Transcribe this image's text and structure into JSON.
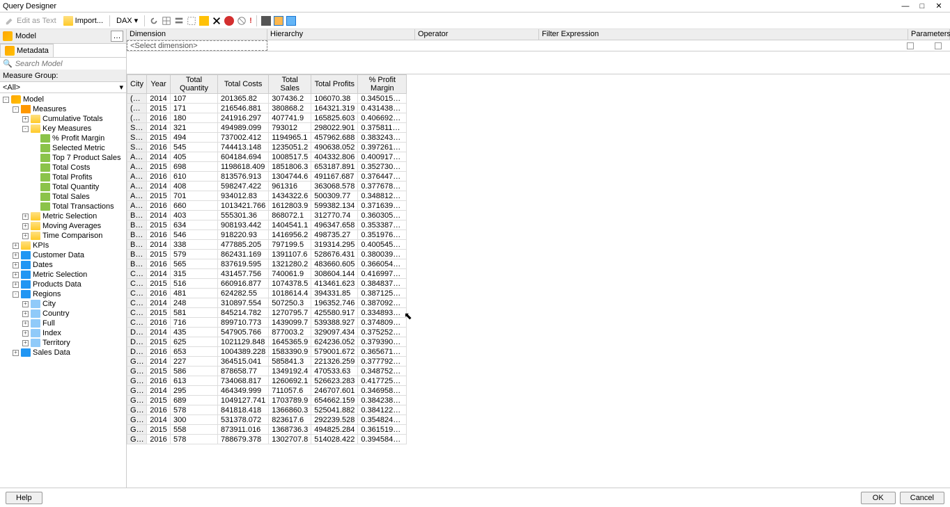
{
  "window": {
    "title": "Query Designer"
  },
  "toolbar": {
    "edit_as_text": "Edit as Text",
    "import": "Import...",
    "mode": "DAX"
  },
  "left": {
    "model_label": "Model",
    "metadata_tab": "Metadata",
    "search_placeholder": "Search Model",
    "measure_group_label": "Measure Group:",
    "measure_group_value": "<All>"
  },
  "tree": [
    {
      "d": 0,
      "e": "-",
      "i": "cube",
      "t": "Model"
    },
    {
      "d": 1,
      "e": "-",
      "i": "bars",
      "t": "Measures"
    },
    {
      "d": 2,
      "e": "+",
      "i": "folder",
      "t": "Cumulative Totals"
    },
    {
      "d": 2,
      "e": "-",
      "i": "folder",
      "t": "Key Measures"
    },
    {
      "d": 3,
      "e": "",
      "i": "calc",
      "t": "% Profit Margin"
    },
    {
      "d": 3,
      "e": "",
      "i": "calc",
      "t": "Selected Metric"
    },
    {
      "d": 3,
      "e": "",
      "i": "calc",
      "t": "Top 7 Product Sales"
    },
    {
      "d": 3,
      "e": "",
      "i": "calc",
      "t": "Total Costs"
    },
    {
      "d": 3,
      "e": "",
      "i": "calc",
      "t": "Total Profits"
    },
    {
      "d": 3,
      "e": "",
      "i": "calc",
      "t": "Total Quantity"
    },
    {
      "d": 3,
      "e": "",
      "i": "calc",
      "t": "Total Sales"
    },
    {
      "d": 3,
      "e": "",
      "i": "calc",
      "t": "Total Transactions"
    },
    {
      "d": 2,
      "e": "+",
      "i": "folder",
      "t": "Metric Selection"
    },
    {
      "d": 2,
      "e": "+",
      "i": "folder",
      "t": "Moving Averages"
    },
    {
      "d": 2,
      "e": "+",
      "i": "folder",
      "t": "Time Comparison"
    },
    {
      "d": 1,
      "e": "+",
      "i": "folder",
      "t": "KPIs"
    },
    {
      "d": 1,
      "e": "+",
      "i": "dim",
      "t": "Customer Data"
    },
    {
      "d": 1,
      "e": "+",
      "i": "dim",
      "t": "Dates"
    },
    {
      "d": 1,
      "e": "+",
      "i": "dim",
      "t": "Metric Selection"
    },
    {
      "d": 1,
      "e": "+",
      "i": "dim",
      "t": "Products Data"
    },
    {
      "d": 1,
      "e": "-",
      "i": "dim",
      "t": "Regions"
    },
    {
      "d": 2,
      "e": "+",
      "i": "attr",
      "t": "City"
    },
    {
      "d": 2,
      "e": "+",
      "i": "attr",
      "t": "Country"
    },
    {
      "d": 2,
      "e": "+",
      "i": "attr",
      "t": "Full"
    },
    {
      "d": 2,
      "e": "+",
      "i": "attr",
      "t": "Index"
    },
    {
      "d": 2,
      "e": "+",
      "i": "attr",
      "t": "Territory"
    },
    {
      "d": 1,
      "e": "+",
      "i": "dim",
      "t": "Sales Data"
    }
  ],
  "filter": {
    "dimension": "Dimension",
    "hierarchy": "Hierarchy",
    "operator": "Operator",
    "expression": "Filter Expression",
    "parameters": "Parameters",
    "select_dim": "<Select dimension>"
  },
  "grid": {
    "headers": [
      "City",
      "Year",
      "Total Quantity",
      "Total Costs",
      "Total Sales",
      "Total Profits",
      "% Profit Margin"
    ],
    "rows": [
      [
        "(null)",
        "2014",
        "107",
        "201365.82",
        "307436.2",
        "106070.38",
        "0.34501590899..."
      ],
      [
        "(null)",
        "2015",
        "171",
        "216546.881",
        "380868.2",
        "164321.319",
        "0.43143879956..."
      ],
      [
        "(null)",
        "2016",
        "180",
        "241916.297",
        "407741.9",
        "165825.603",
        "0.40669257439..."
      ],
      [
        "Syd...",
        "2014",
        "321",
        "494989.099",
        "793012",
        "298022.901",
        "0.37581133828..."
      ],
      [
        "Syd...",
        "2015",
        "494",
        "737002.412",
        "1194965.1",
        "457962.688",
        "0.38324356753..."
      ],
      [
        "Syd...",
        "2016",
        "545",
        "744413.148",
        "1235051.2",
        "490638.052",
        "0.39726130544..."
      ],
      [
        "Alb...",
        "2014",
        "405",
        "604184.694",
        "1008517.5",
        "404332.806",
        "0.40091798704..."
      ],
      [
        "Alb...",
        "2015",
        "698",
        "1198618.409",
        "1851806.3",
        "653187.891",
        "0.35273013759..."
      ],
      [
        "Alb...",
        "2016",
        "610",
        "813576.913",
        "1304744.6",
        "491167.687",
        "0.37644738058..."
      ],
      [
        "Ar...",
        "2014",
        "408",
        "598247.422",
        "961316",
        "363068.578",
        "0.37767870086..."
      ],
      [
        "Ar...",
        "2015",
        "701",
        "934012.83",
        "1434322.6",
        "500309.77",
        "0.34881258232..."
      ],
      [
        "Ar...",
        "2016",
        "660",
        "1013421.766",
        "1612803.9",
        "599382.134",
        "0.37163980940..."
      ],
      [
        "Bat...",
        "2014",
        "403",
        "555301.36",
        "868072.1",
        "312770.74",
        "0.36030502535..."
      ],
      [
        "Bat...",
        "2015",
        "634",
        "908193.442",
        "1404541.1",
        "496347.658",
        "0.35338777768..."
      ],
      [
        "Bat...",
        "2016",
        "546",
        "918220.93",
        "1416956.2",
        "498735.27",
        "0.35197649016..."
      ],
      [
        "Bro...",
        "2014",
        "338",
        "477885.205",
        "797199.5",
        "319314.295",
        "0.40054502668..."
      ],
      [
        "Bro...",
        "2015",
        "579",
        "862431.169",
        "1391107.6",
        "528676.431",
        "0.38003992717..."
      ],
      [
        "Bro...",
        "2016",
        "565",
        "837619.595",
        "1321280.2",
        "483660.605",
        "0.36605453180..."
      ],
      [
        "Ces...",
        "2014",
        "315",
        "431457.756",
        "740061.9",
        "308604.144",
        "0.41699774572..."
      ],
      [
        "Ces...",
        "2015",
        "516",
        "660916.877",
        "1074378.5",
        "413461.623",
        "0.38483795329..."
      ],
      [
        "Ces...",
        "2016",
        "481",
        "624282.55",
        "1018614.4",
        "394331.85",
        "0.38712573668..."
      ],
      [
        "Cof...",
        "2014",
        "248",
        "310897.554",
        "507250.3",
        "196352.746",
        "0.38709241965..."
      ],
      [
        "Cof...",
        "2015",
        "581",
        "845214.782",
        "1270795.7",
        "425580.917",
        "0.33489326254..."
      ],
      [
        "Cof...",
        "2016",
        "716",
        "899710.773",
        "1439099.7",
        "539388.927",
        "0.37480997807..."
      ],
      [
        "Du...",
        "2014",
        "435",
        "547905.766",
        "877003.2",
        "329097.434",
        "0.37525226133..."
      ],
      [
        "Du...",
        "2015",
        "625",
        "1021129.848",
        "1645365.9",
        "624236.052",
        "0.37939041522..."
      ],
      [
        "Du...",
        "2016",
        "653",
        "1004389.228",
        "1583390.9",
        "579001.672",
        "0.36567197146..."
      ],
      [
        "Go...",
        "2014",
        "227",
        "364515.041",
        "585841.3",
        "221326.259",
        "0.37779217511..."
      ],
      [
        "Go...",
        "2015",
        "586",
        "878658.77",
        "1349192.4",
        "470533.63",
        "0.34875206086..."
      ],
      [
        "Go...",
        "2016",
        "613",
        "734068.817",
        "1260692.1",
        "526623.283",
        "0.41772553583..."
      ],
      [
        "Go...",
        "2014",
        "295",
        "464349.999",
        "711057.6",
        "246707.601",
        "0.34695867254..."
      ],
      [
        "Go...",
        "2015",
        "689",
        "1049127.741",
        "1703789.9",
        "654662.159",
        "0.38423878373..."
      ],
      [
        "Go...",
        "2016",
        "578",
        "841818.418",
        "1366860.3",
        "525041.882",
        "0.38412256322..."
      ],
      [
        "Gra...",
        "2014",
        "300",
        "531378.072",
        "823617.6",
        "292239.528",
        "0.35482428738..."
      ],
      [
        "Gra...",
        "2015",
        "558",
        "873911.016",
        "1368736.3",
        "494825.284",
        "0.36151980772..."
      ],
      [
        "Gra...",
        "2016",
        "578",
        "788679.378",
        "1302707.8",
        "514028.422",
        "0.39458458911..."
      ]
    ]
  },
  "buttons": {
    "help": "Help",
    "ok": "OK",
    "cancel": "Cancel"
  }
}
